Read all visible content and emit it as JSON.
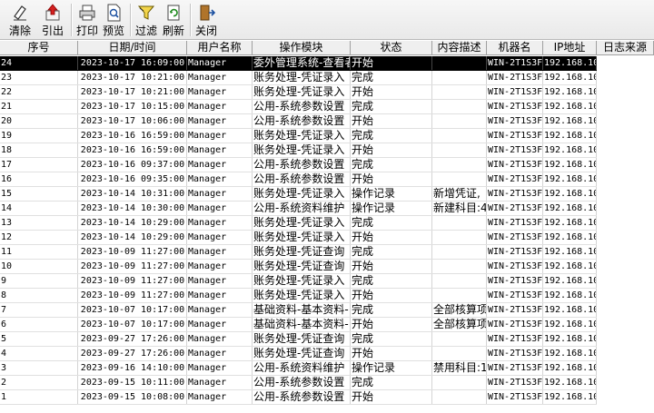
{
  "toolbar": {
    "clear": "清除",
    "export": "引出",
    "print": "打印",
    "preview": "预览",
    "filter": "过滤",
    "refresh": "刷新",
    "close": "关闭"
  },
  "columns": [
    "序号",
    "日期/时间",
    "用户名称",
    "操作模块",
    "状态",
    "内容描述",
    "机器名",
    "IP地址",
    "日志来源"
  ],
  "rows": [
    {
      "id": "24",
      "dt": "2023-10-17 16:09:00",
      "user": "Manager",
      "module": "委外管理系统-查看者",
      "status": "开始",
      "desc": "",
      "machine": "WIN-2T1S3F",
      "ip": "192.168.10"
    },
    {
      "id": "23",
      "dt": "2023-10-17 10:21:00",
      "user": "Manager",
      "module": "账务处理-凭证录入",
      "status": "完成",
      "desc": "",
      "machine": "WIN-2T1S3F",
      "ip": "192.168.10"
    },
    {
      "id": "22",
      "dt": "2023-10-17 10:21:00",
      "user": "Manager",
      "module": "账务处理-凭证录入",
      "status": "开始",
      "desc": "",
      "machine": "WIN-2T1S3F",
      "ip": "192.168.10"
    },
    {
      "id": "21",
      "dt": "2023-10-17 10:15:00",
      "user": "Manager",
      "module": "公用-系统参数设置",
      "status": "完成",
      "desc": "",
      "machine": "WIN-2T1S3F",
      "ip": "192.168.10"
    },
    {
      "id": "20",
      "dt": "2023-10-17 10:06:00",
      "user": "Manager",
      "module": "公用-系统参数设置",
      "status": "开始",
      "desc": "",
      "machine": "WIN-2T1S3F",
      "ip": "192.168.10"
    },
    {
      "id": "19",
      "dt": "2023-10-16 16:59:00",
      "user": "Manager",
      "module": "账务处理-凭证录入",
      "status": "完成",
      "desc": "",
      "machine": "WIN-2T1S3F",
      "ip": "192.168.10"
    },
    {
      "id": "18",
      "dt": "2023-10-16 16:59:00",
      "user": "Manager",
      "module": "账务处理-凭证录入",
      "status": "开始",
      "desc": "",
      "machine": "WIN-2T1S3F",
      "ip": "192.168.10"
    },
    {
      "id": "17",
      "dt": "2023-10-16 09:37:00",
      "user": "Manager",
      "module": "公用-系统参数设置",
      "status": "完成",
      "desc": "",
      "machine": "WIN-2T1S3F",
      "ip": "192.168.10"
    },
    {
      "id": "16",
      "dt": "2023-10-16 09:35:00",
      "user": "Manager",
      "module": "公用-系统参数设置",
      "status": "开始",
      "desc": "",
      "machine": "WIN-2T1S3F",
      "ip": "192.168.10"
    },
    {
      "id": "15",
      "dt": "2023-10-14 10:31:00",
      "user": "Manager",
      "module": "账务处理-凭证录入",
      "status": "操作记录",
      "desc": "新增凭证,",
      "machine": "WIN-2T1S3F",
      "ip": "192.168.10"
    },
    {
      "id": "14",
      "dt": "2023-10-14 10:30:00",
      "user": "Manager",
      "module": "公用-系统资料维护",
      "status": "操作记录",
      "desc": "新建科目:4",
      "machine": "WIN-2T1S3F",
      "ip": "192.168.10"
    },
    {
      "id": "13",
      "dt": "2023-10-14 10:29:00",
      "user": "Manager",
      "module": "账务处理-凭证录入",
      "status": "完成",
      "desc": "",
      "machine": "WIN-2T1S3F",
      "ip": "192.168.10"
    },
    {
      "id": "12",
      "dt": "2023-10-14 10:29:00",
      "user": "Manager",
      "module": "账务处理-凭证录入",
      "status": "开始",
      "desc": "",
      "machine": "WIN-2T1S3F",
      "ip": "192.168.10"
    },
    {
      "id": "11",
      "dt": "2023-10-09 11:27:00",
      "user": "Manager",
      "module": "账务处理-凭证查询",
      "status": "完成",
      "desc": "",
      "machine": "WIN-2T1S3F",
      "ip": "192.168.10"
    },
    {
      "id": "10",
      "dt": "2023-10-09 11:27:00",
      "user": "Manager",
      "module": "账务处理-凭证查询",
      "status": "开始",
      "desc": "",
      "machine": "WIN-2T1S3F",
      "ip": "192.168.10"
    },
    {
      "id": "9",
      "dt": "2023-10-09 11:27:00",
      "user": "Manager",
      "module": "账务处理-凭证录入",
      "status": "完成",
      "desc": "",
      "machine": "WIN-2T1S3F",
      "ip": "192.168.10"
    },
    {
      "id": "8",
      "dt": "2023-10-09 11:27:00",
      "user": "Manager",
      "module": "账务处理-凭证录入",
      "status": "开始",
      "desc": "",
      "machine": "WIN-2T1S3F",
      "ip": "192.168.10"
    },
    {
      "id": "7",
      "dt": "2023-10-07 10:17:00",
      "user": "Manager",
      "module": "基础资料-基本资料-",
      "status": "完成",
      "desc": "全部核算项",
      "machine": "WIN-2T1S3F",
      "ip": "192.168.10"
    },
    {
      "id": "6",
      "dt": "2023-10-07 10:17:00",
      "user": "Manager",
      "module": "基础资料-基本资料-",
      "status": "开始",
      "desc": "全部核算项",
      "machine": "WIN-2T1S3F",
      "ip": "192.168.10"
    },
    {
      "id": "5",
      "dt": "2023-09-27 17:26:00",
      "user": "Manager",
      "module": "账务处理-凭证查询",
      "status": "完成",
      "desc": "",
      "machine": "WIN-2T1S3F",
      "ip": "192.168.10"
    },
    {
      "id": "4",
      "dt": "2023-09-27 17:26:00",
      "user": "Manager",
      "module": "账务处理-凭证查询",
      "status": "开始",
      "desc": "",
      "machine": "WIN-2T1S3F",
      "ip": "192.168.10"
    },
    {
      "id": "3",
      "dt": "2023-09-16 14:10:00",
      "user": "Manager",
      "module": "公用-系统资料维护",
      "status": "操作记录",
      "desc": "禁用科目:1",
      "machine": "WIN-2T1S3F",
      "ip": "192.168.10"
    },
    {
      "id": "2",
      "dt": "2023-09-15 10:11:00",
      "user": "Manager",
      "module": "公用-系统参数设置",
      "status": "完成",
      "desc": "",
      "machine": "WIN-2T1S3F",
      "ip": "192.168.10"
    },
    {
      "id": "1",
      "dt": "2023-09-15 10:08:00",
      "user": "Manager",
      "module": "公用-系统参数设置",
      "status": "开始",
      "desc": "",
      "machine": "WIN-2T1S3F",
      "ip": "192.168.10"
    }
  ],
  "selected_row": 0
}
